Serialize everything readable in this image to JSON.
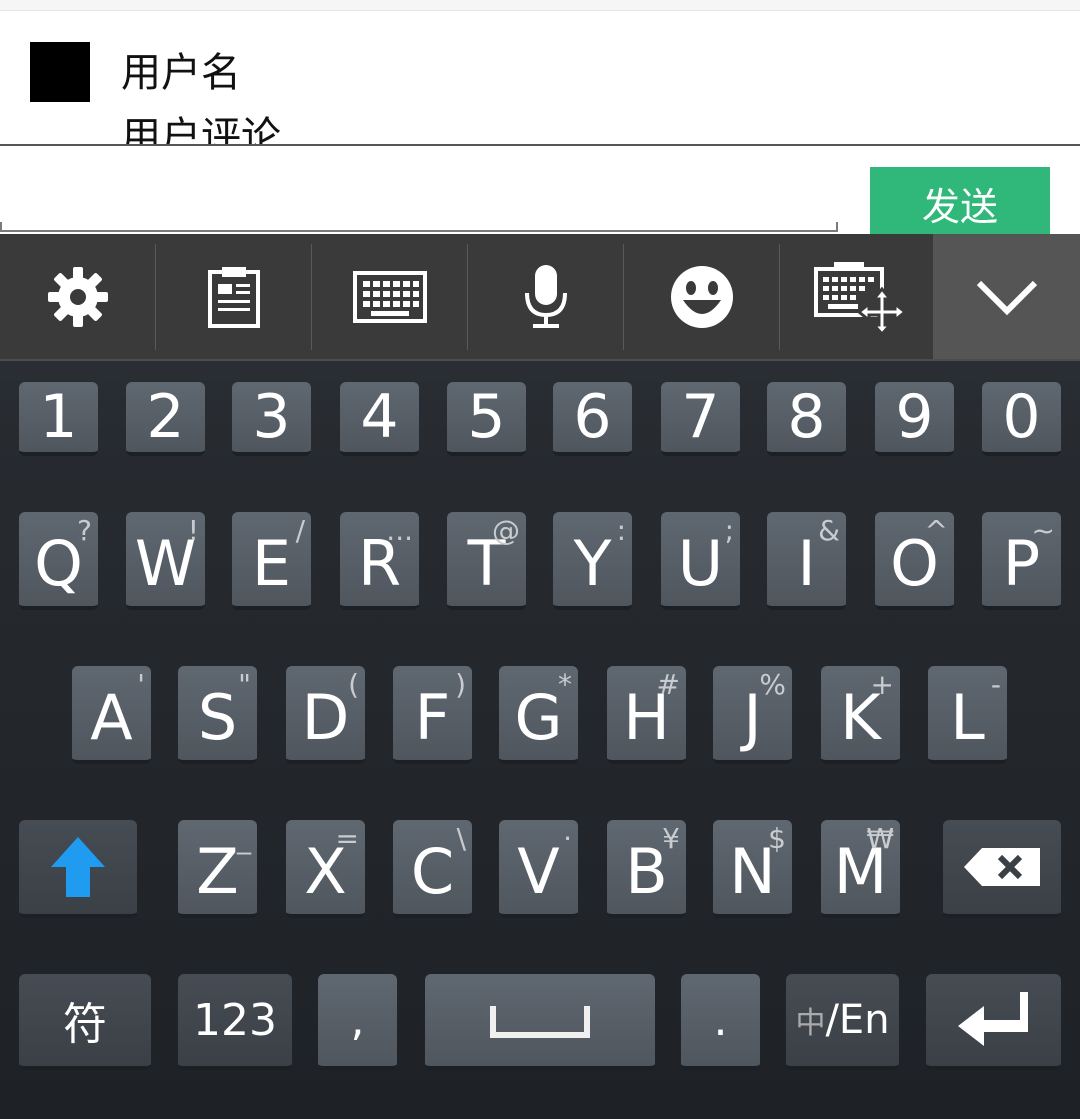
{
  "comment": {
    "username": "用户名",
    "text": "用户评论"
  },
  "input": {
    "value": "",
    "placeholder": "",
    "send_label": "发送"
  },
  "toolbar": {
    "items": [
      "settings-icon",
      "clipboard-icon",
      "keyboard-icon",
      "microphone-icon",
      "emoji-icon",
      "keyboard-move-icon"
    ],
    "collapse": "chevron-down-icon"
  },
  "keyboard": {
    "numbers": [
      "1",
      "2",
      "3",
      "4",
      "5",
      "6",
      "7",
      "8",
      "9",
      "0"
    ],
    "row_q": [
      {
        "k": "Q",
        "s": "?"
      },
      {
        "k": "W",
        "s": "!"
      },
      {
        "k": "E",
        "s": "/"
      },
      {
        "k": "R",
        "s": "..."
      },
      {
        "k": "T",
        "s": "@"
      },
      {
        "k": "Y",
        "s": ":"
      },
      {
        "k": "U",
        "s": ";"
      },
      {
        "k": "I",
        "s": "&"
      },
      {
        "k": "O",
        "s": "^"
      },
      {
        "k": "P",
        "s": "~"
      }
    ],
    "row_a": [
      {
        "k": "A",
        "s": "'"
      },
      {
        "k": "S",
        "s": "\""
      },
      {
        "k": "D",
        "s": "("
      },
      {
        "k": "F",
        "s": ")"
      },
      {
        "k": "G",
        "s": "*"
      },
      {
        "k": "H",
        "s": "#"
      },
      {
        "k": "J",
        "s": "%"
      },
      {
        "k": "K",
        "s": "+"
      },
      {
        "k": "L",
        "s": "-"
      }
    ],
    "row_z": [
      {
        "k": "Z",
        "s": "_"
      },
      {
        "k": "X",
        "s": "="
      },
      {
        "k": "C",
        "s": "\\"
      },
      {
        "k": "V",
        "s": "·"
      },
      {
        "k": "B",
        "s": "¥"
      },
      {
        "k": "N",
        "s": "$"
      },
      {
        "k": "M",
        "s": "₩"
      }
    ],
    "bottom": {
      "symbols": "符",
      "num": "123",
      "comma": ",",
      "period": ".",
      "lang_zh": "中",
      "lang_en": "/En"
    },
    "colors": {
      "shift_arrow": "#1f9bf0",
      "send": "#2fb87a"
    }
  }
}
